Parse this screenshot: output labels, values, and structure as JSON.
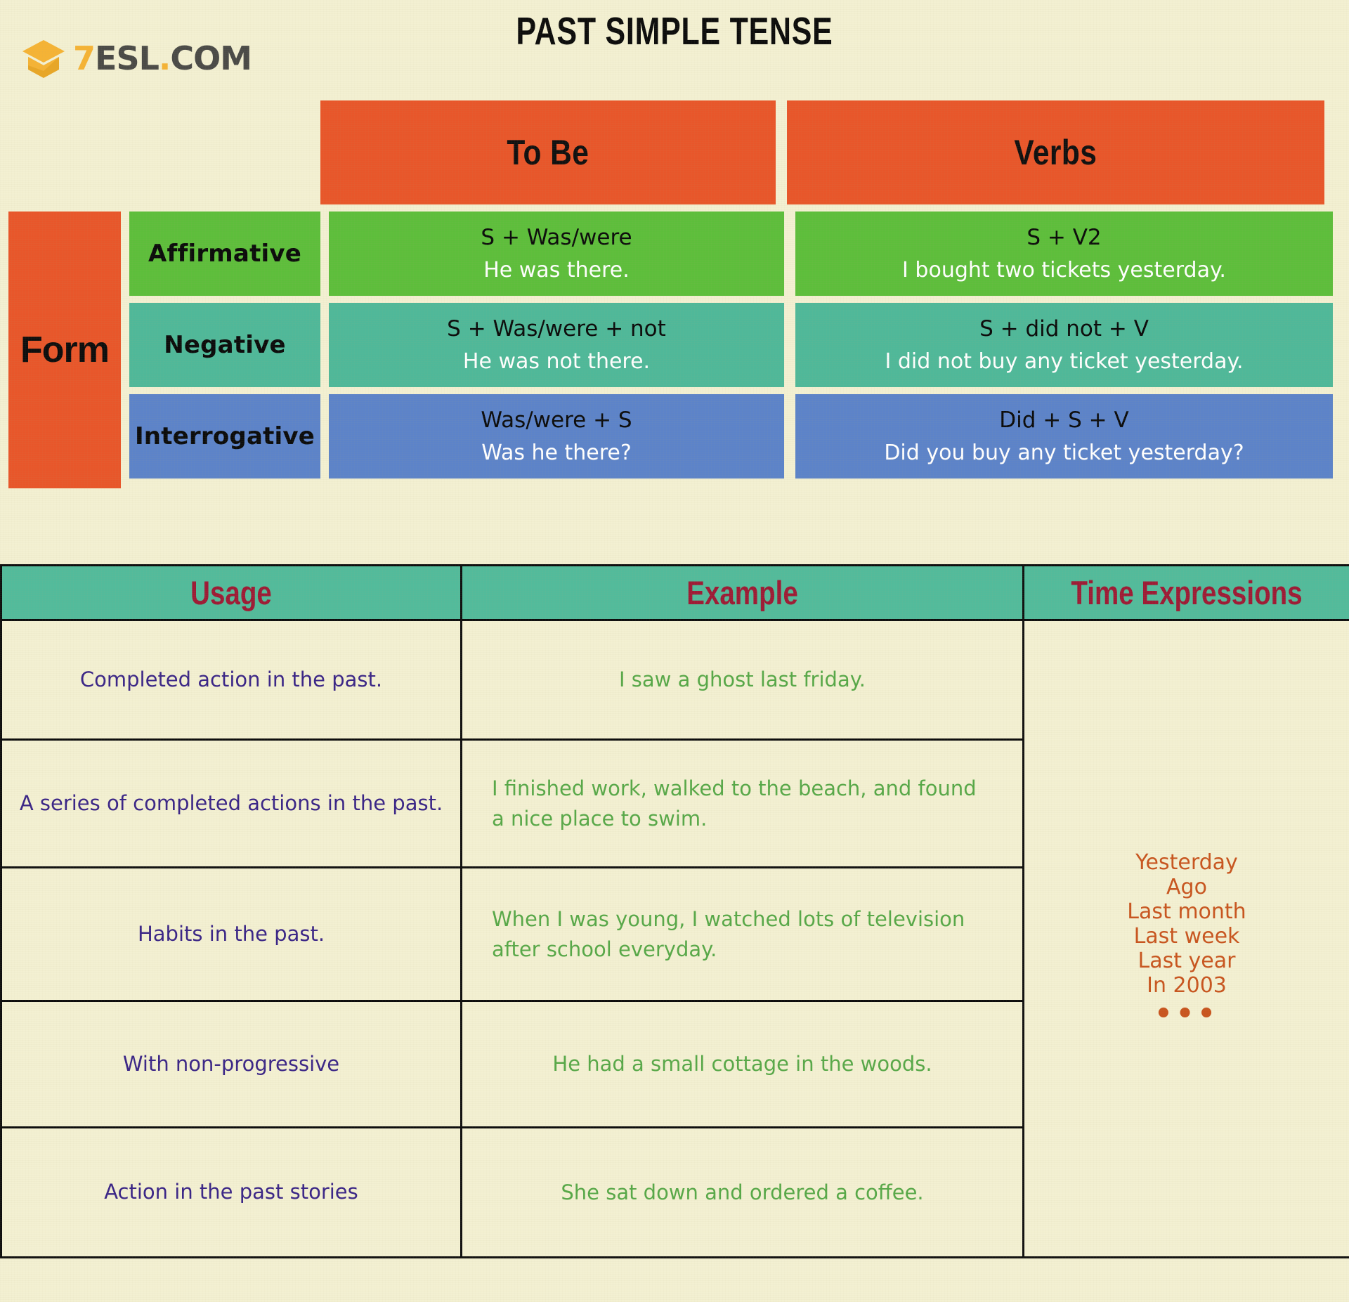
{
  "brand": {
    "logo_icon": "graduation-cap-icon",
    "name_seven": "7",
    "name_rest": "ESL",
    "name_dot": ".",
    "name_tld": "COM"
  },
  "header": {
    "title": "PAST SIMPLE TENSE"
  },
  "colors": {
    "paper": "#F3F0D2",
    "orange": "#E8562A",
    "green": "#5DBE3B",
    "teal": "#4FB899",
    "blue": "#5C83C9",
    "header_teal": "#52BB9B",
    "dark_red": "#9D1B35",
    "usage_purple": "#3A2587",
    "example_green": "#57A848",
    "time_orange": "#C8551F",
    "logo_yellow": "#F5B335"
  },
  "form_table": {
    "row_label": "Form",
    "column_headers": [
      "To Be",
      "Verbs"
    ],
    "rows": [
      {
        "type": "Affirmative",
        "to_be_formula": "S + Was/were",
        "to_be_example": "He was there.",
        "verbs_formula": "S + V2",
        "verbs_example": "I bought two tickets yesterday."
      },
      {
        "type": "Negative",
        "to_be_formula": "S + Was/were + not",
        "to_be_example": "He was not there.",
        "verbs_formula": "S + did not + V",
        "verbs_example": "I did not buy any ticket yesterday."
      },
      {
        "type": "Interrogative",
        "to_be_formula": "Was/were + S",
        "to_be_example": "Was he there?",
        "verbs_formula": "Did + S + V",
        "verbs_example": "Did you buy any ticket yesterday?"
      }
    ]
  },
  "usage_table": {
    "headers": [
      "Usage",
      "Example",
      "Time Expressions"
    ],
    "rows": [
      {
        "usage": "Completed action in the past.",
        "example": "I saw a ghost last friday."
      },
      {
        "usage": "A series of completed actions in the past.",
        "example": "I finished work, walked to the beach, and found a nice place to swim."
      },
      {
        "usage": "Habits in the past.",
        "example": "When I was young, I watched lots of television after school everyday."
      },
      {
        "usage": "With non-progressive",
        "example": "He had a small cottage in the woods."
      },
      {
        "usage": "Action in the past stories",
        "example": "She sat down and ordered a coffee."
      }
    ],
    "time_expressions": [
      "Yesterday",
      "Ago",
      "Last month",
      "Last week",
      "Last year",
      "In 2003",
      "•••"
    ]
  }
}
